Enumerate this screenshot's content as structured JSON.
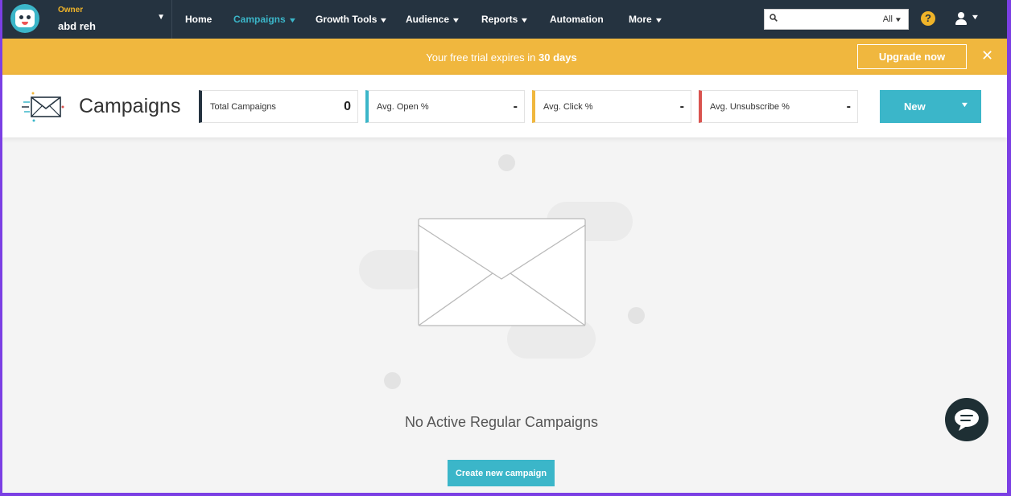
{
  "navbar": {
    "account_role": "Owner",
    "account_name": "abd reh",
    "items": [
      {
        "label": "Home",
        "has_dropdown": false,
        "active": false
      },
      {
        "label": "Campaigns",
        "has_dropdown": true,
        "active": true
      },
      {
        "label": "Growth Tools",
        "has_dropdown": true,
        "active": false
      },
      {
        "label": "Audience",
        "has_dropdown": true,
        "active": false
      },
      {
        "label": "Reports",
        "has_dropdown": true,
        "active": false
      },
      {
        "label": "Automation",
        "has_dropdown": false,
        "active": false
      },
      {
        "label": "More",
        "has_dropdown": true,
        "active": false
      }
    ],
    "search": {
      "value": "",
      "scope": "All"
    },
    "help_glyph": "?"
  },
  "banner": {
    "message_prefix": "Your free trial expires in",
    "message_highlight": "30 days",
    "upgrade_label": "Upgrade now",
    "close_glyph": "✕"
  },
  "header": {
    "title": "Campaigns",
    "stats": [
      {
        "label": "Total Campaigns",
        "value": "0",
        "color": "#253340"
      },
      {
        "label": "Avg. Open %",
        "value": "-",
        "color": "#3bb6c9"
      },
      {
        "label": "Avg. Click %",
        "value": "-",
        "color": "#f0b73e"
      },
      {
        "label": "Avg. Unsubscribe %",
        "value": "-",
        "color": "#d9534f"
      }
    ],
    "new_label": "New"
  },
  "empty_state": {
    "message": "No Active Regular Campaigns",
    "create_label": "Create new campaign"
  },
  "colors": {
    "navbar_bg": "#253340",
    "accent": "#3bb6c9",
    "banner_bg": "#f0b73e",
    "chat_bg": "#1e2f34"
  },
  "icons": {
    "logo": "mascot-logo",
    "search": "search-icon",
    "help": "help-icon",
    "user": "user-icon",
    "close": "close-icon",
    "chat": "chat-icon"
  }
}
